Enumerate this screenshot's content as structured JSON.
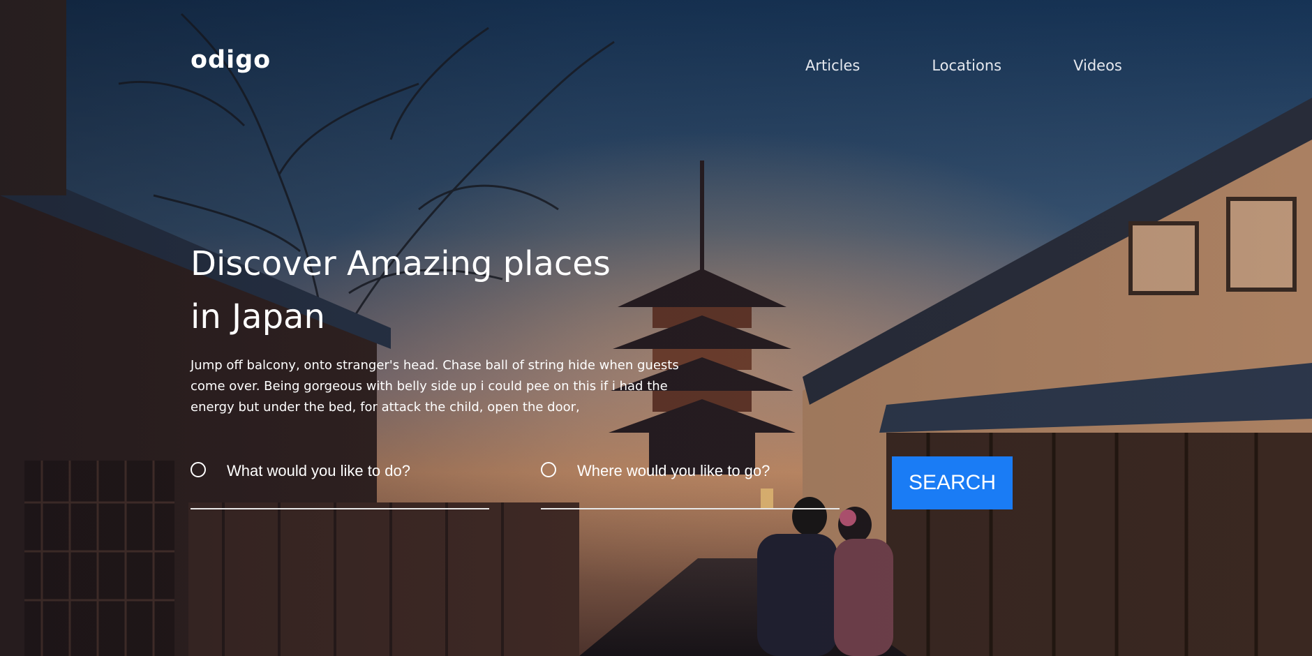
{
  "header": {
    "logo_text": "odigo",
    "nav": [
      "Articles",
      "Locations",
      "Videos"
    ]
  },
  "hero": {
    "title": "Discover Amazing places in Japan",
    "description": "Jump off balcony, onto stranger's head. Chase ball of string hide when guests come over. Being gorgeous with belly side up i could pee on this if i had the energy but under the bed, for attack the child, open the door,"
  },
  "search": {
    "activity_placeholder": "What would you like to do?",
    "location_placeholder": "Where would you like to go?",
    "button_label": "SEARCH"
  },
  "colors": {
    "accent": "#1a7cf5",
    "text": "#ffffff"
  }
}
